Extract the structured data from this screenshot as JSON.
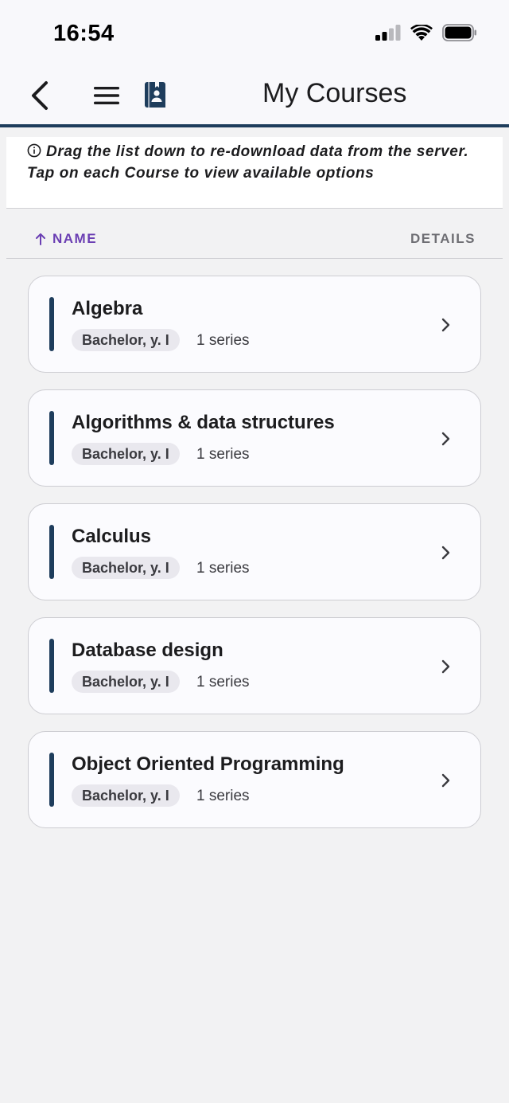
{
  "status": {
    "time": "16:54"
  },
  "nav": {
    "title": "My Courses"
  },
  "info": {
    "line1": "Drag the list down to re-download data from the server.",
    "line2": "Tap on each Course to view available options"
  },
  "sort": {
    "name_label": "NAME",
    "details_label": "DETAILS"
  },
  "courses": [
    {
      "title": "Algebra",
      "badge": "Bachelor, y. I",
      "series": "1 series"
    },
    {
      "title": "Algorithms & data structures",
      "badge": "Bachelor, y. I",
      "series": "1 series"
    },
    {
      "title": "Calculus",
      "badge": "Bachelor, y. I",
      "series": "1 series"
    },
    {
      "title": "Database design",
      "badge": "Bachelor, y. I",
      "series": "1 series"
    },
    {
      "title": "Object Oriented Programming",
      "badge": "Bachelor, y. I",
      "series": "1 series"
    }
  ],
  "colors": {
    "accent": "#1e3d5c",
    "sort_active": "#6b3fb3"
  },
  "icons": [
    "signal-icon",
    "wifi-icon",
    "battery-icon",
    "back-icon",
    "menu-icon",
    "course-book-icon",
    "info-icon",
    "arrow-up-icon",
    "chevron-right-icon"
  ]
}
